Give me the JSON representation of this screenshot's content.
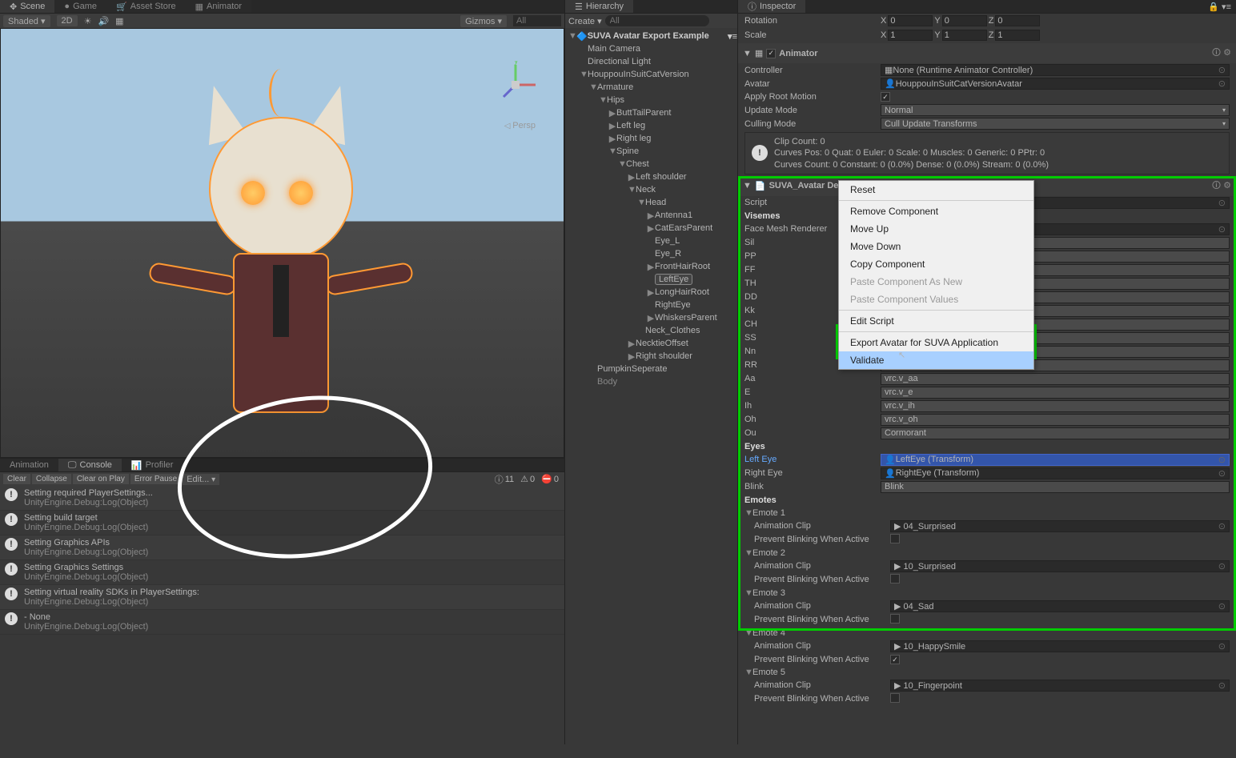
{
  "tabs_top_left": [
    "Scene",
    "Game",
    "Asset Store",
    "Animator"
  ],
  "scene_toolbar": {
    "shaded": "Shaded",
    "twod": "2D",
    "gizmos": "Gizmos",
    "search": "All"
  },
  "persp_label": "Persp",
  "tabs_console": [
    "Animation",
    "Console",
    "Profiler"
  ],
  "console_toolbar": {
    "clear": "Clear",
    "collapse": "Collapse",
    "clearonplay": "Clear on Play",
    "errorpause": "Error Pause",
    "editor": "Edit...",
    "info_count": "11",
    "warn_count": "0",
    "err_count": "0"
  },
  "logs": [
    {
      "t": "Setting required PlayerSettings...",
      "s": "UnityEngine.Debug:Log(Object)"
    },
    {
      "t": "Setting build target",
      "s": "UnityEngine.Debug:Log(Object)"
    },
    {
      "t": "Setting Graphics APIs",
      "s": "UnityEngine.Debug:Log(Object)"
    },
    {
      "t": "Setting Graphics Settings",
      "s": "UnityEngine.Debug:Log(Object)"
    },
    {
      "t": "Setting virtual reality SDKs in PlayerSettings:",
      "s": "UnityEngine.Debug:Log(Object)"
    },
    {
      "t": "- None",
      "s": "UnityEngine.Debug:Log(Object)"
    }
  ],
  "hierarchy_tab": "Hierarchy",
  "hierarchy_toolbar": {
    "create": "Create",
    "search": "All"
  },
  "hierarchy": {
    "scene": "SUVA Avatar Export Example",
    "items": [
      {
        "d": 1,
        "l": "Main Camera"
      },
      {
        "d": 1,
        "l": "Directional Light"
      },
      {
        "d": 1,
        "l": "HouppouInSuitCatVersion",
        "f": "▼"
      },
      {
        "d": 2,
        "l": "Armature",
        "f": "▼"
      },
      {
        "d": 3,
        "l": "Hips",
        "f": "▼"
      },
      {
        "d": 4,
        "l": "ButtTailParent",
        "f": "▶"
      },
      {
        "d": 4,
        "l": "Left leg",
        "f": "▶"
      },
      {
        "d": 4,
        "l": "Right leg",
        "f": "▶"
      },
      {
        "d": 4,
        "l": "Spine",
        "f": "▼"
      },
      {
        "d": 5,
        "l": "Chest",
        "f": "▼"
      },
      {
        "d": 6,
        "l": "Left shoulder",
        "f": "▶"
      },
      {
        "d": 6,
        "l": "Neck",
        "f": "▼"
      },
      {
        "d": 7,
        "l": "Head",
        "f": "▼"
      },
      {
        "d": 8,
        "l": "Antenna1",
        "f": "▶"
      },
      {
        "d": 8,
        "l": "CatEarsParent",
        "f": "▶"
      },
      {
        "d": 8,
        "l": "Eye_L"
      },
      {
        "d": 8,
        "l": "Eye_R"
      },
      {
        "d": 8,
        "l": "FrontHairRoot",
        "f": "▶"
      },
      {
        "d": 8,
        "l": "LeftEye",
        "box": true
      },
      {
        "d": 8,
        "l": "LongHairRoot",
        "f": "▶"
      },
      {
        "d": 8,
        "l": "RightEye"
      },
      {
        "d": 8,
        "l": "WhiskersParent",
        "f": "▶"
      },
      {
        "d": 7,
        "l": "Neck_Clothes"
      },
      {
        "d": 6,
        "l": "NecktieOffset",
        "f": "▶"
      },
      {
        "d": 6,
        "l": "Right shoulder",
        "f": "▶"
      },
      {
        "d": 2,
        "l": "PumpkinSeperate"
      },
      {
        "d": 2,
        "l": "Body",
        "dim": true
      }
    ]
  },
  "inspector_tab": "Inspector",
  "transform": {
    "rotation": {
      "label": "Rotation",
      "x": "0",
      "y": "0",
      "z": "0"
    },
    "scale": {
      "label": "Scale",
      "x": "1",
      "y": "1",
      "z": "1"
    }
  },
  "animator": {
    "title": "Animator",
    "controller_lbl": "Controller",
    "controller_val": "None (Runtime Animator Controller)",
    "avatar_lbl": "Avatar",
    "avatar_val": "HouppouInSuitCatVersionAvatar",
    "apply_root_lbl": "Apply Root Motion",
    "update_mode_lbl": "Update Mode",
    "update_mode_val": "Normal",
    "culling_lbl": "Culling Mode",
    "culling_val": "Cull Update Transforms",
    "info_l1": "Clip Count: 0",
    "info_l2": "Curves Pos: 0 Quat: 0 Euler: 0 Scale: 0 Muscles: 0 Generic: 0 PPtr: 0",
    "info_l3": "Curves Count: 0 Constant: 0 (0.0%) Dense: 0 (0.0%) Stream: 0 (0.0%)"
  },
  "suva": {
    "title": "SUVA_Avatar Descriptor (Script)",
    "script_lbl": "Script",
    "visemes_hdr": "Visemes",
    "facemesh_lbl": "Face Mesh Renderer",
    "visemes": [
      {
        "k": "Sil",
        "v": ""
      },
      {
        "k": "PP",
        "v": ""
      },
      {
        "k": "FF",
        "v": ""
      },
      {
        "k": "TH",
        "v": ""
      },
      {
        "k": "DD",
        "v": ""
      },
      {
        "k": "Kk",
        "v": ""
      },
      {
        "k": "CH",
        "v": ""
      },
      {
        "k": "SS",
        "v": ""
      },
      {
        "k": "Nn",
        "v": ""
      },
      {
        "k": "RR",
        "v": ""
      },
      {
        "k": "Aa",
        "v": "vrc.v_aa"
      },
      {
        "k": "E",
        "v": "vrc.v_e"
      },
      {
        "k": "Ih",
        "v": "vrc.v_ih"
      },
      {
        "k": "Oh",
        "v": "vrc.v_oh"
      },
      {
        "k": "Ou",
        "v": "Cormorant"
      }
    ],
    "eyes_hdr": "Eyes",
    "lefteye_lbl": "Left Eye",
    "lefteye_val": "LeftEye (Transform)",
    "righteye_lbl": "Right Eye",
    "righteye_val": "RightEye (Transform)",
    "blink_lbl": "Blink",
    "blink_val": "Blink",
    "emotes_hdr": "Emotes",
    "emotes": [
      {
        "n": "Emote 1",
        "clip": "04_Surprised",
        "chk": false
      },
      {
        "n": "Emote 2",
        "clip": "10_Surprised",
        "chk": false
      },
      {
        "n": "Emote 3",
        "clip": "04_Sad",
        "chk": false
      },
      {
        "n": "Emote 4",
        "clip": "10_HappySmile",
        "chk": true
      },
      {
        "n": "Emote 5",
        "clip": "10_Fingerpoint",
        "chk": false
      }
    ],
    "anim_clip_lbl": "Animation Clip",
    "prevent_lbl": "Prevent Blinking When Active"
  },
  "context_menu": {
    "items": [
      {
        "l": "Reset"
      },
      {
        "sep": true
      },
      {
        "l": "Remove Component"
      },
      {
        "l": "Move Up"
      },
      {
        "l": "Move Down"
      },
      {
        "l": "Copy Component"
      },
      {
        "l": "Paste Component As New",
        "d": true
      },
      {
        "l": "Paste Component Values",
        "d": true
      },
      {
        "sep": true
      },
      {
        "l": "Edit Script"
      },
      {
        "sep": true
      },
      {
        "l": "Export Avatar for SUVA Application"
      },
      {
        "l": "Validate",
        "hl": true
      }
    ]
  }
}
